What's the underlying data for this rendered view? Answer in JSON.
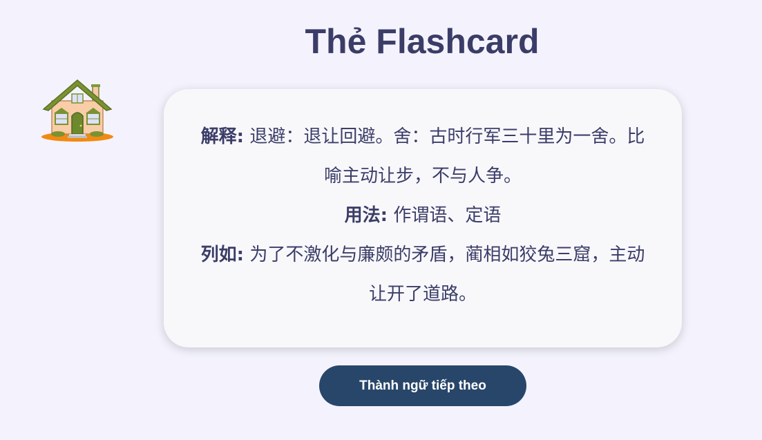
{
  "header": {
    "title": "Thẻ Flashcard",
    "home_icon": "house-icon"
  },
  "card": {
    "meaning_label": "解释:",
    "meaning_text": "退避：退让回避。舍：古时行军三十里为一舍。比喻主动让步，不与人争。",
    "usage_label": "用法:",
    "usage_text": "作谓语、定语",
    "example_label": "列如:",
    "example_text": "为了不激化与廉颇的矛盾，蔺相如狡兔三窟，主动让开了道路。"
  },
  "actions": {
    "next_label": "Thành ngữ tiếp theo"
  },
  "colors": {
    "background": "#f4f3fd",
    "title": "#3b3d68",
    "card": "#f8f8fb",
    "button": "#284669"
  }
}
